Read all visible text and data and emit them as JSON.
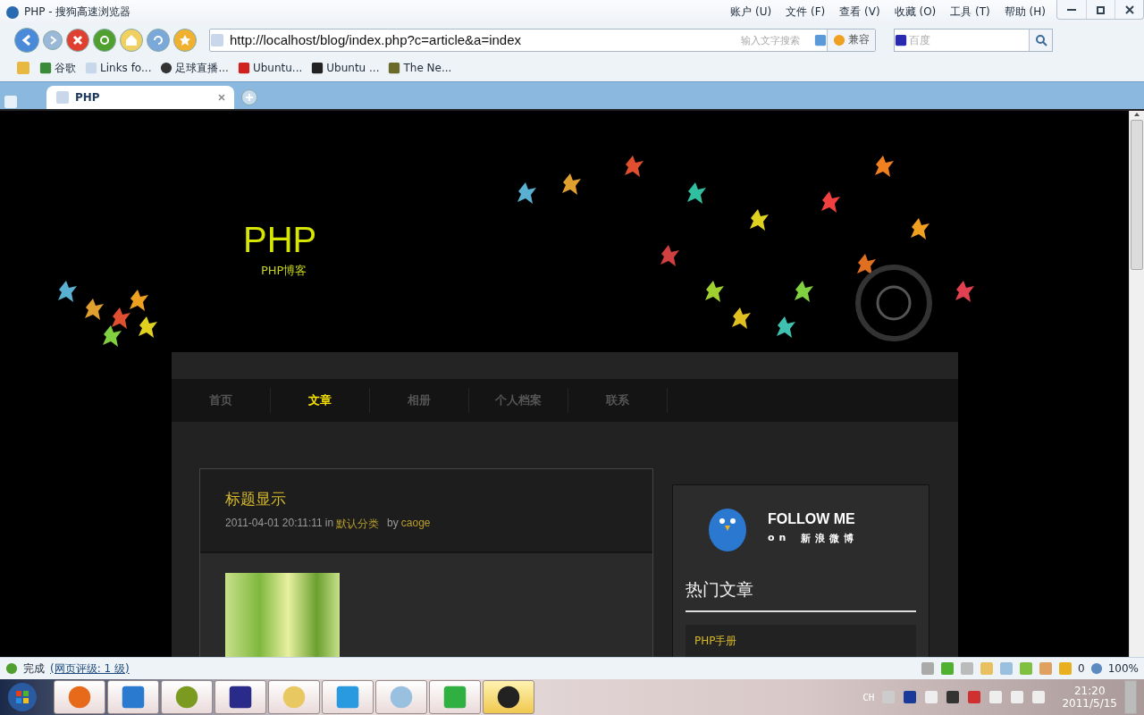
{
  "browser": {
    "title": "PHP - 搜狗高速浏览器",
    "menu": [
      "账户 (U)",
      "文件 (F)",
      "查看 (V)",
      "收藏 (O)",
      "工具 (T)",
      "帮助 (H)"
    ],
    "address": "http://localhost/blog/index.php?c=article&a=index",
    "address_search_placeholder": "输入文字搜索",
    "compat_button": "兼容",
    "search_placeholder": "百度"
  },
  "bookmarks": [
    "谷歌",
    "Links fo...",
    "足球直播...",
    "Ubuntu...",
    "Ubuntu ...",
    "The Ne..."
  ],
  "tabs": [
    {
      "label": "PHP",
      "selected": true
    }
  ],
  "page": {
    "site_title": "PHP",
    "site_subtitle": "PHP博客",
    "nav": [
      {
        "label": "首页",
        "selected": false
      },
      {
        "label": "文章",
        "selected": true
      },
      {
        "label": "相册",
        "selected": false
      },
      {
        "label": "个人档案",
        "selected": false
      },
      {
        "label": "联系",
        "selected": false
      }
    ],
    "post": {
      "title": "标题显示",
      "date": "2011-04-01 20:11:11",
      "in_word": "in",
      "category": "默认分类",
      "by_word": "by",
      "author": "caoge"
    },
    "sidebar": {
      "follow_title": "FOLLOW ME",
      "follow_on": "on",
      "follow_site": "新浪微博",
      "hot_title": "热门文章",
      "hot_items": [
        "PHP手册"
      ]
    }
  },
  "status_bar": {
    "status": "完成",
    "rating": "(网页评级: 1 级)",
    "shield_count": "0",
    "zoom": "100%"
  },
  "taskbar": {
    "apps": [
      {
        "selected": false
      },
      {
        "selected": false
      },
      {
        "selected": false
      },
      {
        "selected": false
      },
      {
        "selected": false
      },
      {
        "selected": false
      },
      {
        "selected": false
      },
      {
        "selected": false
      },
      {
        "selected": true
      }
    ],
    "lang": "CH",
    "time": "21:20",
    "date": "2011/5/15"
  }
}
